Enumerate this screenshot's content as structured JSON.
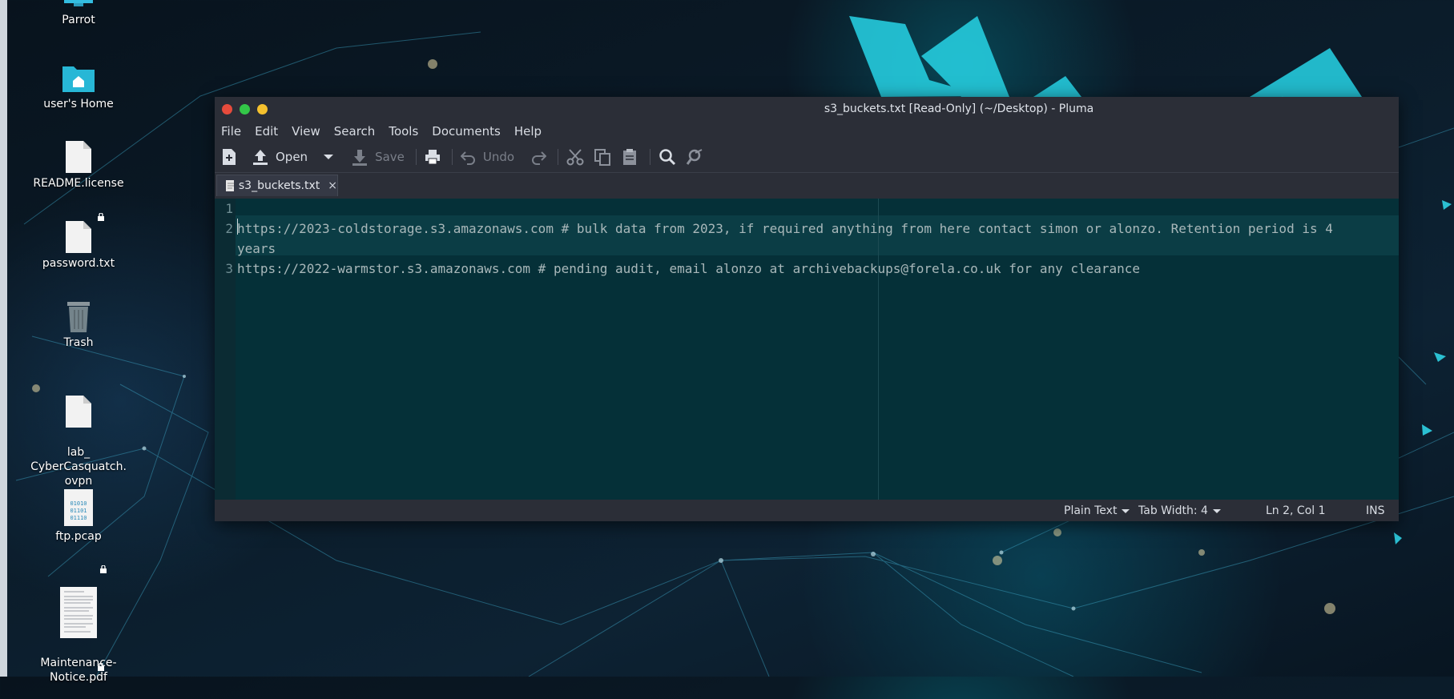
{
  "desktop": {
    "icons": [
      {
        "label": "Parrot"
      },
      {
        "label": "user's Home"
      },
      {
        "label": "README.license"
      },
      {
        "label": "password.txt"
      },
      {
        "label": "Trash"
      },
      {
        "label": "lab_\nCyberCasquatch.\novpn"
      },
      {
        "label": "ftp.pcap"
      },
      {
        "label": "Maintenance-\nNotice.pdf"
      }
    ],
    "pcap_glyph_lines": [
      "01010",
      "01101",
      "01110"
    ]
  },
  "window": {
    "title": "s3_buckets.txt [Read-Only] (~/Desktop) - Pluma",
    "menu": [
      "File",
      "Edit",
      "View",
      "Search",
      "Tools",
      "Documents",
      "Help"
    ],
    "toolbar": {
      "open_label": "Open",
      "save_label": "Save",
      "undo_label": "Undo"
    },
    "tab": {
      "label": "s3_buckets.txt",
      "close": "×"
    },
    "editor": {
      "line_numbers": [
        "1",
        "2",
        "3"
      ],
      "lines": [
        "",
        "https://2023-coldstorage.s3.amazonaws.com # bulk data from 2023, if required anything from here contact simon or alonzo. Retention period is 4",
        "years",
        "https://2022-warmstor.s3.amazonaws.com # pending audit, email alonzo at archivebackups@forela.co.uk for any clearance"
      ]
    },
    "status": {
      "language": "Plain Text",
      "tab_width": "Tab Width:  4",
      "position": "Ln 2, Col 1",
      "mode": "INS"
    }
  },
  "colors": {
    "close": "#e64b3c",
    "maximize": "#33c748",
    "minimize": "#f5c12e",
    "editor_bg": "#053038",
    "window_bg": "#2b2e37"
  }
}
